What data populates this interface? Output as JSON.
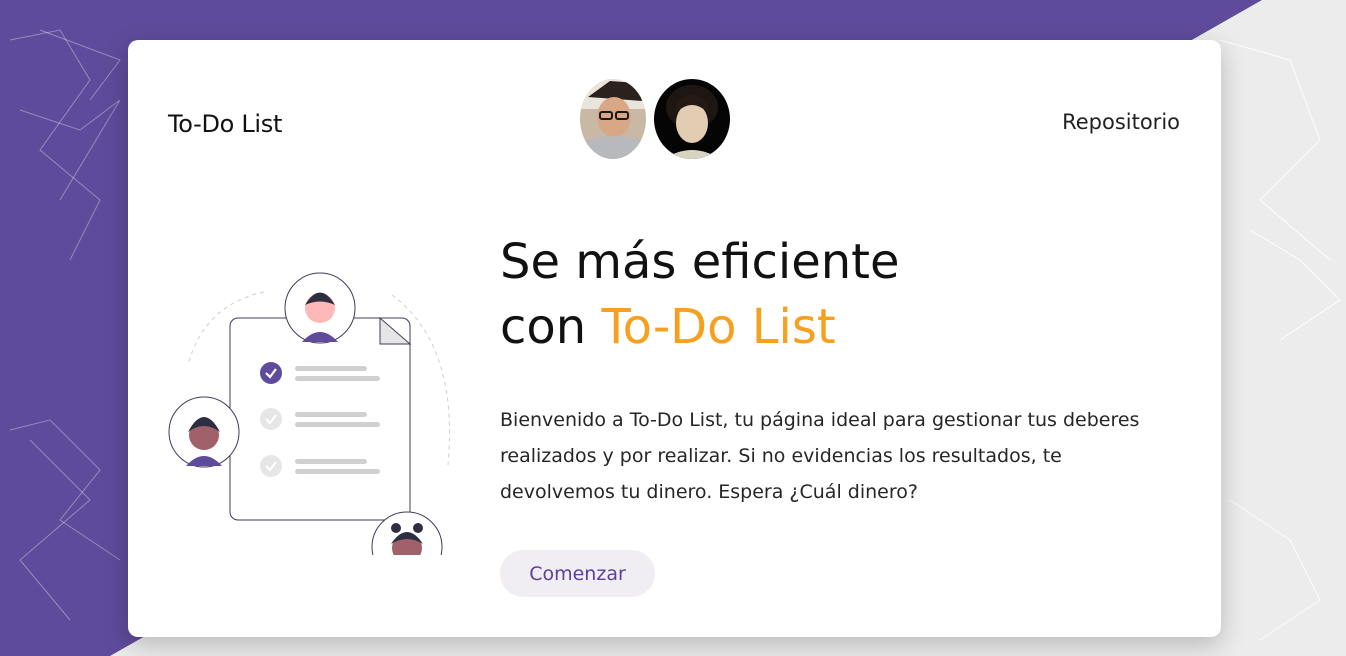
{
  "header": {
    "brand": "To-Do List",
    "repo_link": "Repositorio"
  },
  "hero": {
    "line1": "Se más eficiente",
    "line2_prefix": "con ",
    "line2_accent": "To-Do List"
  },
  "description": "Bienvenido a To-Do List, tu página ideal para gestionar tus deberes realizados y por realizar. Si no evidencias los resultados, te devolvemos tu dinero. Espera ¿Cuál dinero?",
  "cta": {
    "label": "Comenzar"
  },
  "colors": {
    "purple": "#5f4b9b",
    "accent": "#f5a01f",
    "card": "#ffffff"
  }
}
